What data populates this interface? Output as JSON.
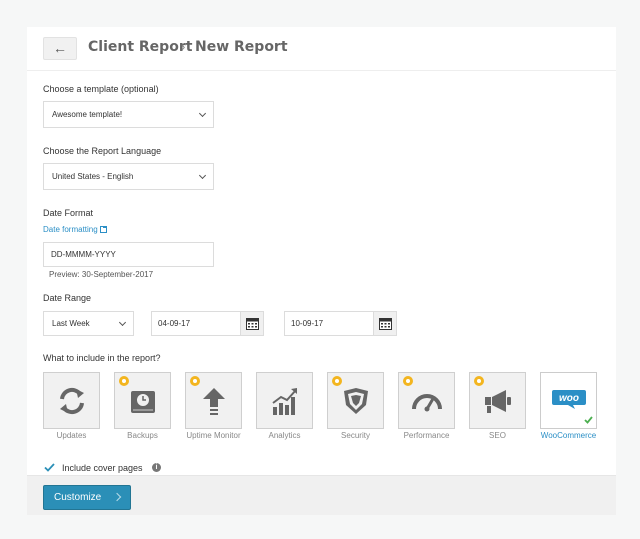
{
  "header": {
    "back_label": "←",
    "crumb_parent": "Client Report",
    "crumb_separator": "›",
    "crumb_current": "New Report"
  },
  "template": {
    "label": "Choose a template (optional)",
    "selected": "Awesome template!"
  },
  "language": {
    "label": "Choose the Report Language",
    "selected": "United States - English"
  },
  "date_format": {
    "label": "Date Format",
    "link": "Date formatting",
    "value": "DD-MMMM-YYYY",
    "preview": "Preview: 30-September-2017"
  },
  "date_range": {
    "label": "Date Range",
    "preset": "Last Week",
    "from": "04-09-17",
    "to": "10-09-17"
  },
  "include": {
    "label": "What to include in the report?",
    "items": [
      {
        "label": "Updates",
        "icon": "refresh-icon",
        "premium": false,
        "active": false
      },
      {
        "label": "Backups",
        "icon": "backup-icon",
        "premium": true,
        "active": false
      },
      {
        "label": "Uptime Monitor",
        "icon": "upload-arrow-icon",
        "premium": true,
        "active": false
      },
      {
        "label": "Analytics",
        "icon": "analytics-chart-icon",
        "premium": false,
        "active": false
      },
      {
        "label": "Security",
        "icon": "shield-icon",
        "premium": true,
        "active": false
      },
      {
        "label": "Performance",
        "icon": "gauge-icon",
        "premium": true,
        "active": false
      },
      {
        "label": "SEO",
        "icon": "megaphone-icon",
        "premium": true,
        "active": false
      },
      {
        "label": "WooCommerce",
        "icon": "woo-logo",
        "premium": false,
        "active": true,
        "logo_text": "woo"
      }
    ]
  },
  "cover": {
    "label": "Include cover pages",
    "checked": true,
    "info_glyph": "i"
  },
  "footer": {
    "button_label": "Customize"
  },
  "colors": {
    "accent": "#2b8fb7",
    "link": "#2b8fc6",
    "premium_star": "#f3b51f",
    "check": "#4caf50"
  }
}
